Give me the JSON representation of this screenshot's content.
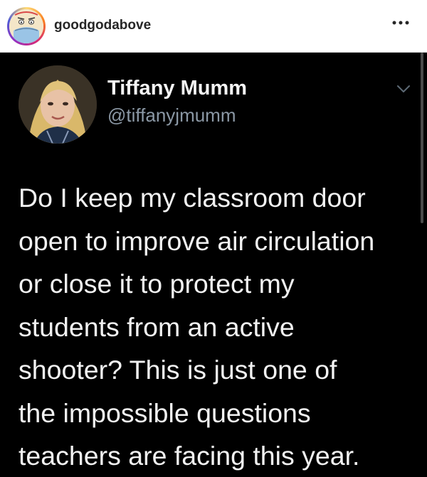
{
  "instagram": {
    "username": "goodgodabove",
    "more_icon": "ellipsis-icon"
  },
  "tweet": {
    "display_name": "Tiffany Mumm",
    "handle": "@tiffanyjmumm",
    "text_lines": [
      "Do I keep my classroom door",
      "open to improve air circulation",
      "or close it to protect my",
      "students from an active",
      "shooter? This is just one of",
      "the impossible questions",
      "teachers are facing this year."
    ]
  },
  "colors": {
    "header_bg": "#ffffff",
    "tweet_bg": "#000000",
    "text": "#f2f2f2",
    "handle": "#8b98a5"
  }
}
